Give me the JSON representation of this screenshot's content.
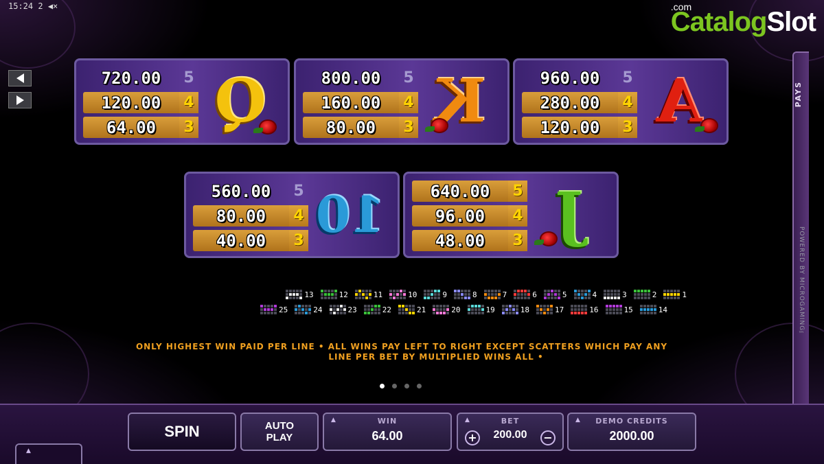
{
  "status_bar": {
    "time": "15:24",
    "battery": "2",
    "mute": "◀×"
  },
  "logo": {
    "part_a": "Slot",
    "part_b": "Catalog",
    "suffix": ".com"
  },
  "side_tab": {
    "label": "PAYS",
    "powered": "POWERED BY MICROGAMING™"
  },
  "paytable": [
    {
      "symbol": "A",
      "color": "#e02010",
      "pays": [
        {
          "count": "5",
          "amount": "960.00"
        },
        {
          "count": "4",
          "amount": "280.00"
        },
        {
          "count": "3",
          "amount": "120.00"
        }
      ]
    },
    {
      "symbol": "K",
      "color": "#f08a10",
      "pays": [
        {
          "count": "5",
          "amount": "800.00"
        },
        {
          "count": "4",
          "amount": "160.00"
        },
        {
          "count": "3",
          "amount": "80.00"
        }
      ]
    },
    {
      "symbol": "Q",
      "color": "#f4c20d",
      "pays": [
        {
          "count": "5",
          "amount": "720.00"
        },
        {
          "count": "4",
          "amount": "120.00"
        },
        {
          "count": "3",
          "amount": "64.00"
        }
      ]
    },
    {
      "symbol": "J",
      "color": "#5ac020",
      "pays": [
        {
          "count": "5",
          "amount": "640.00"
        },
        {
          "count": "4",
          "amount": "96.00"
        },
        {
          "count": "3",
          "amount": "48.00"
        }
      ]
    },
    {
      "symbol": "10",
      "color": "#2a9ad8",
      "pays": [
        {
          "count": "5",
          "amount": "560.00"
        },
        {
          "count": "4",
          "amount": "80.00"
        },
        {
          "count": "3",
          "amount": "40.00"
        }
      ]
    }
  ],
  "paylines": {
    "row1": [
      "1",
      "2",
      "3",
      "4",
      "5",
      "6",
      "7",
      "8",
      "9",
      "10",
      "11",
      "12",
      "13"
    ],
    "row2": [
      "14",
      "15",
      "16",
      "17",
      "18",
      "19",
      "20",
      "21",
      "22",
      "23",
      "24",
      "25"
    ]
  },
  "rules": {
    "line1": "ONLY HIGHEST WIN PAID PER LINE • ALL WINS PAY LEFT TO RIGHT EXCEPT SCATTERS WHICH PAY ANY",
    "line2": "LINE PER BET BY MULTIPLIED WINS ALL •"
  },
  "pagination": {
    "total": 4,
    "active": 1
  },
  "controls": {
    "spin": "SPIN",
    "autoplay_line1": "AUTO",
    "autoplay_line2": "PLAY",
    "win_label": "WIN",
    "win_value": "64.00",
    "bet_label": "BET",
    "bet_value": "200.00",
    "bet_plus": "+",
    "bet_minus": "−",
    "credits_label": "DEMO CREDITS",
    "credits_value": "2000.00"
  }
}
